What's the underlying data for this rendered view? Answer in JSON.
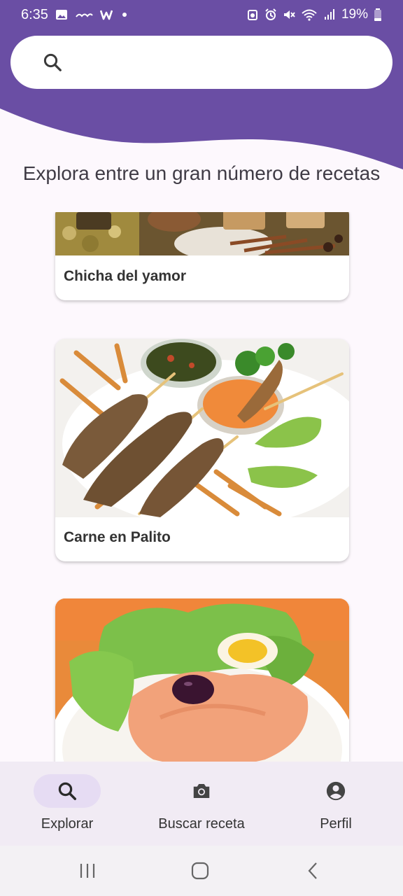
{
  "status_bar": {
    "time": "6:35",
    "notification_icons": [
      "image-icon",
      "ewa-icon",
      "w-icon",
      "dot-icon"
    ],
    "system_icons": [
      "alarm-clock-icon",
      "alarm-icon",
      "mute-icon",
      "wifi-icon",
      "signal-icon"
    ],
    "battery": "19%"
  },
  "search": {
    "icon": "search-icon",
    "value": ""
  },
  "intro": "Explora entre un gran número de recetas",
  "recipes": [
    {
      "title": "Chicha del yamor"
    },
    {
      "title": "Carne en Palito"
    },
    {
      "title": ""
    }
  ],
  "bottom_nav": {
    "items": [
      {
        "label": "Explorar",
        "icon": "search-icon",
        "active": true
      },
      {
        "label": "Buscar receta",
        "icon": "camera-icon",
        "active": false
      },
      {
        "label": "Perfil",
        "icon": "account-circle-icon",
        "active": false
      }
    ]
  },
  "system_nav": [
    "recents-icon",
    "home-icon",
    "back-icon"
  ],
  "colors": {
    "primary": "#6a4ea4",
    "nav_active_pill": "#e6dcf3",
    "background": "#fdf8fd"
  }
}
